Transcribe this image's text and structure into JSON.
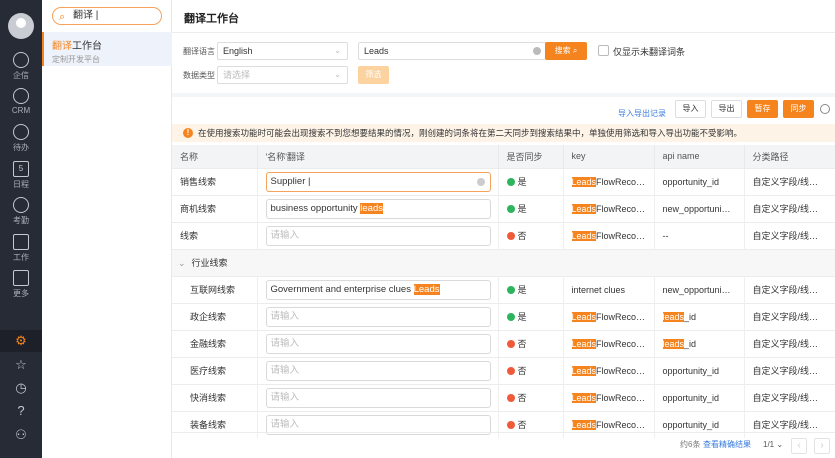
{
  "rail": {
    "items": [
      {
        "label": "企信",
        "icon": "chat-icon"
      },
      {
        "label": "CRM",
        "icon": "pie-chart-icon"
      },
      {
        "label": "待办",
        "icon": "check-circle-icon"
      },
      {
        "label": "日程",
        "icon": "calendar-icon",
        "day": "5"
      },
      {
        "label": "考勤",
        "icon": "location-check-icon"
      },
      {
        "label": "工作",
        "icon": "briefcase-icon"
      },
      {
        "label": "更多",
        "icon": "grid-icon"
      }
    ]
  },
  "panel": {
    "search_value": "翻译 |",
    "result_hl": "翻译",
    "result_rest": "工作台",
    "result_sub": "定制开发平台"
  },
  "header": {
    "title": "翻译工作台"
  },
  "filters": {
    "lang_label": "翻译语言",
    "lang_value": "English",
    "type_label": "数据类型",
    "type_placeholder": "请选择",
    "search_value": "Leads",
    "search_btn": "搜索",
    "filter_btn": "筛选",
    "only_untranslated": "仅显示未翻译词条"
  },
  "toolbar": {
    "history_link": "导入导出记录",
    "import": "导入",
    "export": "导出",
    "save": "暂存",
    "sync": "同步"
  },
  "notice": "在使用搜索功能时可能会出现搜索不到您想要结果的情况，刚创建的词条将在第二天同步到搜索结果中，单独使用筛选和导入导出功能不受影响。",
  "table": {
    "headers": [
      "名称",
      "'名称'翻译",
      "是否同步",
      "key",
      "api name",
      "分类路径"
    ],
    "placeholder": "请输入",
    "group": "行业线索",
    "rows": [
      {
        "name": "销售线索",
        "tr_pre": "Supplier |",
        "tr_hl": "",
        "sync": "是",
        "key_hl": "Leads",
        "key_rest": "FlowReco…",
        "api_hl": "",
        "api_rest": "opportunity_id",
        "path": "自定义字段/线…",
        "focus": true
      },
      {
        "name": "商机线索",
        "tr_pre": "business opportunity ",
        "tr_hl": "leads",
        "sync": "是",
        "key_hl": "Leads",
        "key_rest": "FlowReco…",
        "api_hl": "",
        "api_rest": "new_opportuni…",
        "path": "自定义字段/线…"
      },
      {
        "name": "线索",
        "tr_pre": "",
        "tr_hl": "",
        "sync": "否",
        "key_hl": "Leads",
        "key_rest": "FlowReco…",
        "api_hl": "",
        "api_rest": "--",
        "path": "自定义字段/线…"
      },
      {
        "name": "互联网线索",
        "tr_pre": "Government and enterprise clues ",
        "tr_hl": "Leads",
        "sync": "是",
        "key_hl": "",
        "key_rest": "internet clues",
        "api_hl": "",
        "api_rest": "new_opportuni…",
        "path": "自定义字段/线…",
        "sub": true
      },
      {
        "name": "政企线索",
        "tr_pre": "",
        "tr_hl": "",
        "sync": "是",
        "key_hl": "Leads",
        "key_rest": "FlowReco…",
        "api_hl": "leads",
        "api_rest": "_id",
        "path": "自定义字段/线…",
        "sub": true
      },
      {
        "name": "金融线索",
        "tr_pre": "",
        "tr_hl": "",
        "sync": "否",
        "key_hl": "Leads",
        "key_rest": "FlowReco…",
        "api_hl": "leads",
        "api_rest": "_id",
        "path": "自定义字段/线…",
        "sub": true
      },
      {
        "name": "医疗线索",
        "tr_pre": "",
        "tr_hl": "",
        "sync": "否",
        "key_hl": "Leads",
        "key_rest": "FlowReco…",
        "api_hl": "",
        "api_rest": "opportunity_id",
        "path": "自定义字段/线…",
        "sub": true
      },
      {
        "name": "快消线索",
        "tr_pre": "",
        "tr_hl": "",
        "sync": "否",
        "key_hl": "Leads",
        "key_rest": "FlowReco…",
        "api_hl": "",
        "api_rest": "opportunity_id",
        "path": "自定义字段/线…",
        "sub": true
      },
      {
        "name": "装备线索",
        "tr_pre": "",
        "tr_hl": "",
        "sync": "否",
        "key_hl": "Leads",
        "key_rest": "FlowReco…",
        "api_hl": "",
        "api_rest": "opportunity_id",
        "path": "自定义字段/线…",
        "sub": true
      }
    ]
  },
  "footer": {
    "count": "约6条",
    "exact_link": "查看精确结果",
    "page": "1/1"
  },
  "colors": {
    "accent": "#f5841f",
    "rail": "#272b35",
    "ok": "#2db55d",
    "no": "#ef5b3a"
  }
}
